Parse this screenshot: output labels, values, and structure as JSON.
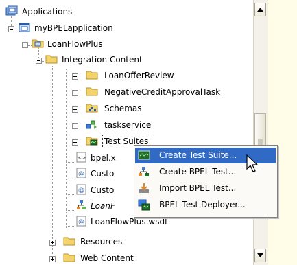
{
  "tree": {
    "items": [
      {
        "label": "Applications",
        "icon": "applications-icon"
      },
      {
        "label": "myBPELapplication",
        "icon": "application-icon"
      },
      {
        "label": "LoanFlowPlus",
        "icon": "project-folder-icon"
      },
      {
        "label": "Integration Content",
        "icon": "folder-icon"
      },
      {
        "label": "LoanOfferReview",
        "icon": "folder-icon"
      },
      {
        "label": "NegativeCreditApprovalTask",
        "icon": "folder-icon"
      },
      {
        "label": "Schemas",
        "icon": "schemas-folder-icon"
      },
      {
        "label": "taskservice",
        "icon": "taskservice-icon"
      },
      {
        "label": "Test Suites",
        "icon": "test-suites-folder-icon"
      },
      {
        "label": "bpel.x",
        "icon": "xml-file-icon"
      },
      {
        "label": "Custo",
        "icon": "wsdl-file-icon"
      },
      {
        "label": "Custo",
        "icon": "wsdl-file-icon"
      },
      {
        "label": "LoanF",
        "icon": "bpel-process-icon"
      },
      {
        "label": "LoanFlowPlus.wsdl",
        "icon": "wsdl-file-icon"
      },
      {
        "label": "Resources",
        "icon": "folder-icon"
      },
      {
        "label": "Web Content",
        "icon": "folder-icon"
      }
    ]
  },
  "context_menu": {
    "items": [
      {
        "label": "Create Test Suite...",
        "icon": "create-test-suite-icon",
        "highlighted": true
      },
      {
        "label": "Create BPEL Test...",
        "icon": "create-bpel-test-icon"
      },
      {
        "label": "Import BPEL Test...",
        "icon": "import-bpel-test-icon"
      },
      {
        "label": "BPEL Test Deployer...",
        "icon": "bpel-test-deployer-icon"
      }
    ]
  },
  "colors": {
    "menu_highlight": "#316ac5",
    "folder": "#f3d36b",
    "right_panel": "#fffde7"
  }
}
